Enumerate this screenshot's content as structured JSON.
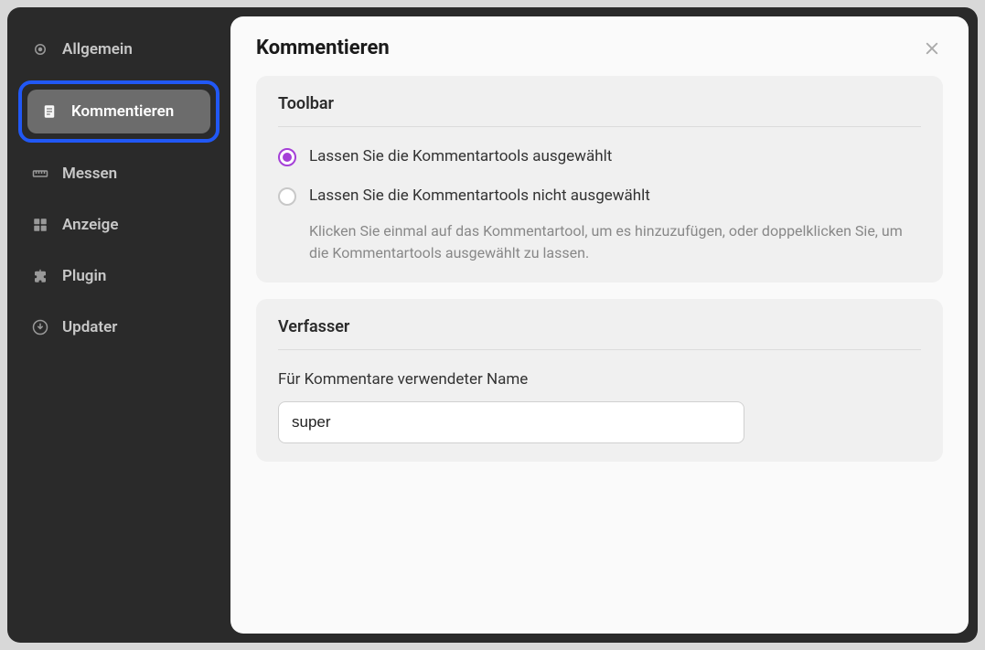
{
  "sidebar": {
    "items": [
      {
        "label": "Allgemein"
      },
      {
        "label": "Kommentieren"
      },
      {
        "label": "Messen"
      },
      {
        "label": "Anzeige"
      },
      {
        "label": "Plugin"
      },
      {
        "label": "Updater"
      }
    ]
  },
  "content": {
    "title": "Kommentieren",
    "toolbar": {
      "heading": "Toolbar",
      "option_keep_selected": "Lassen Sie die Kommentartools ausgewählt",
      "option_not_selected": "Lassen Sie die Kommentartools nicht ausgewählt",
      "helper": "Klicken Sie einmal auf das Kommentartool, um es hinzuzufügen, oder doppelklicken Sie, um die Kommentartools ausgewählt zu lassen."
    },
    "author": {
      "heading": "Verfasser",
      "name_label": "Für Kommentare verwendeter Name",
      "name_value": "super"
    }
  }
}
